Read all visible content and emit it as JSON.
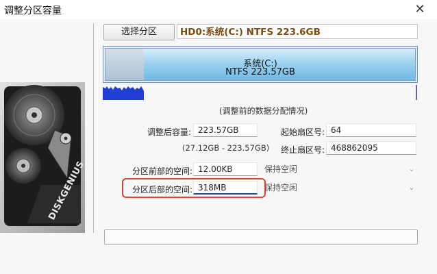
{
  "window": {
    "title": "调整分区容量",
    "close_glyph": "✕"
  },
  "toolbar": {
    "select_partition_label": "选择分区",
    "disk_title": "HD0:系统(C:) NTFS 223.6GB"
  },
  "partition_bar": {
    "name": "系统(C:)",
    "detail": "NTFS 223.57GB"
  },
  "caption": "(调整前的数据分配情况)",
  "fields": {
    "size_label": "调整后容量:",
    "size_value": "223.57GB",
    "size_range": "(27.12GB - 223.57GB)",
    "start_sector_label": "起始扇区号:",
    "start_sector_value": "64",
    "end_sector_label": "终止扇区号:",
    "end_sector_value": "468862095",
    "before_space_label": "分区前部的空间:",
    "before_space_value": "12.00KB",
    "before_space_option": "保持空闲",
    "after_space_label": "分区后部的空间:",
    "after_space_value": "318MB",
    "after_space_option": "保持空闲"
  },
  "icons": {
    "close": "close-icon",
    "dropdown": "chevron-down-icon",
    "disk_image": "hard-disk-image"
  },
  "logo_text": "DISKGENIUS",
  "colors": {
    "highlight": "#d9432f",
    "disk_title_text": "#7a4b10",
    "usage_bar": "#1f3fd6"
  }
}
